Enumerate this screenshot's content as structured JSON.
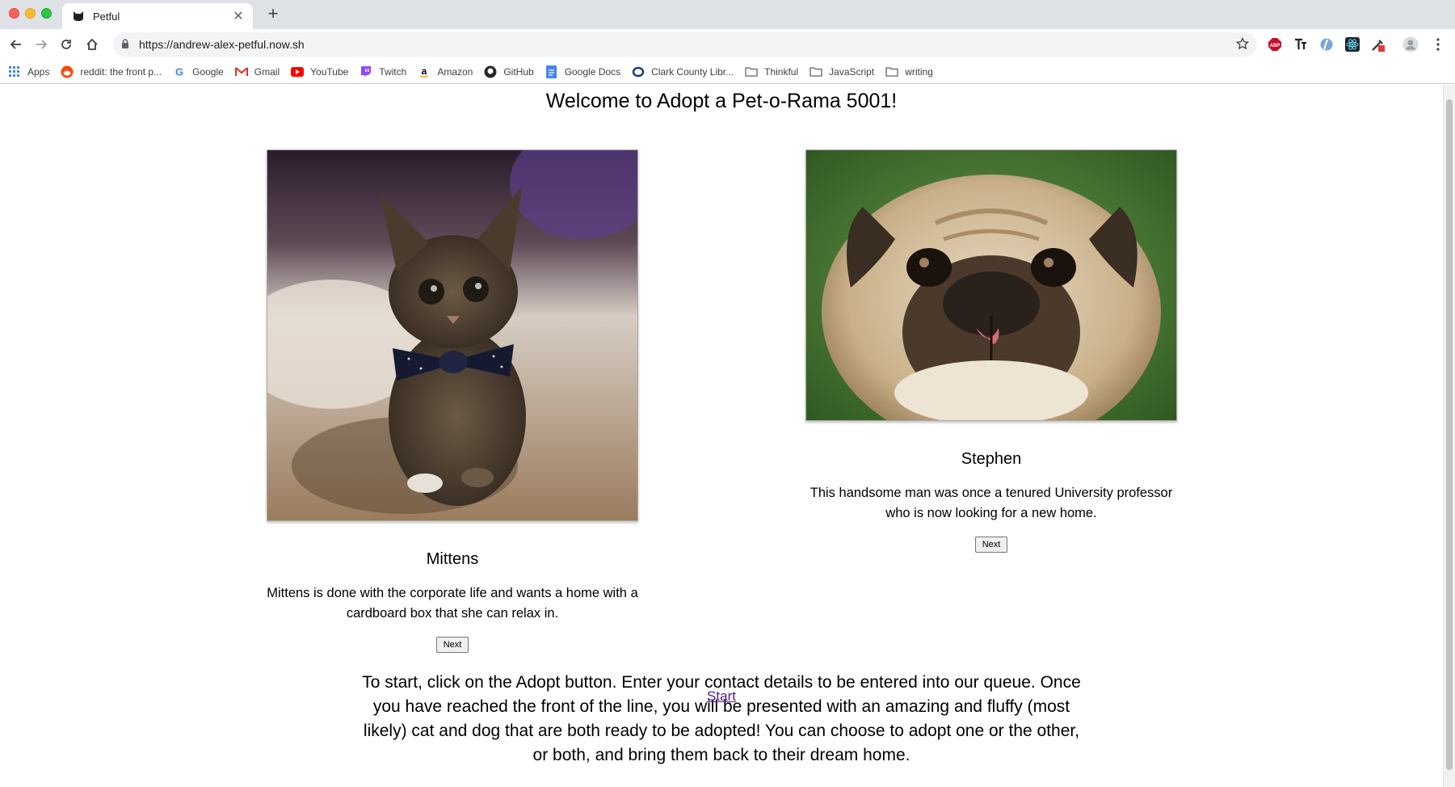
{
  "browser": {
    "tab_title": "Petful",
    "url": "https://andrew-alex-petful.now.sh",
    "bookmarks": [
      {
        "label": "Apps",
        "icon": "apps-grid-icon",
        "color": "#4285f4"
      },
      {
        "label": "reddit: the front p...",
        "icon": "reddit-icon",
        "color": "#ff4500"
      },
      {
        "label": "Google",
        "icon": "google-icon",
        "color": "#4285f4"
      },
      {
        "label": "Gmail",
        "icon": "gmail-icon",
        "color": "#d93025"
      },
      {
        "label": "YouTube",
        "icon": "youtube-icon",
        "color": "#ff0000"
      },
      {
        "label": "Twitch",
        "icon": "twitch-icon",
        "color": "#9146ff"
      },
      {
        "label": "Amazon",
        "icon": "amazon-icon",
        "color": "#000000"
      },
      {
        "label": "GitHub",
        "icon": "github-icon",
        "color": "#24292e"
      },
      {
        "label": "Google Docs",
        "icon": "google-docs-icon",
        "color": "#4285f4"
      },
      {
        "label": "Clark County Libr...",
        "icon": "library-icon",
        "color": "#1a3d6d"
      },
      {
        "label": "Thinkful",
        "icon": "folder-icon",
        "color": "#5f6368"
      },
      {
        "label": "JavaScript",
        "icon": "folder-icon",
        "color": "#5f6368"
      },
      {
        "label": "writing",
        "icon": "folder-icon",
        "color": "#5f6368"
      }
    ],
    "extensions": [
      "adblock-plus-icon",
      "text-format-icon",
      "blue-circle-extension-icon",
      "react-devtools-icon",
      "eyedropper-extension-icon",
      "profile-avatar-icon"
    ]
  },
  "page": {
    "title": "Welcome to Adopt a Pet-o-Rama 5001!",
    "cat": {
      "name": "Mittens",
      "description": "Mittens is done with the corporate life and wants a home with a cardboard box that she can relax in.",
      "next_label": "Next",
      "image": "kitten-with-bowtie-photo"
    },
    "dog": {
      "name": "Stephen",
      "description": "This handsome man was once a tenured University professor who is now looking for a new home.",
      "next_label": "Next",
      "image": "pug-photo"
    },
    "intro": "To start, click on the Adopt button. Enter your contact details to be entered into our queue. Once you have reached the front of the line, you will be presented with an amazing and fluffy (most likely) cat and dog that are both ready to be adopted! You can choose to adopt one or the other, or both, and bring them back to their dream home.",
    "start_label": "Start"
  }
}
